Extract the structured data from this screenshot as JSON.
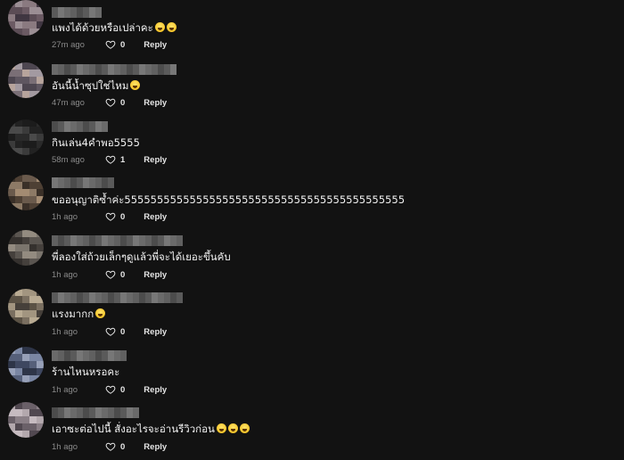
{
  "comments": [
    {
      "text": "แพงได้ด้วยหรือเปล่าคะ",
      "emoji_count": 2,
      "time": "27m ago",
      "likes": "0",
      "reply": "Reply"
    },
    {
      "text": "อันนี้น้ำซุปใช่ไหม",
      "emoji_count": 1,
      "time": "47m ago",
      "likes": "0",
      "reply": "Reply"
    },
    {
      "text": "กินเล่น4คำพอ5555",
      "emoji_count": 0,
      "time": "58m ago",
      "likes": "1",
      "reply": "Reply"
    },
    {
      "text": "ขออนุญาติซ้ำค่ะ5555555555555555555555555555555555555555555",
      "emoji_count": 0,
      "time": "1h ago",
      "likes": "0",
      "reply": "Reply"
    },
    {
      "text": "พี่ลองใส่ถ้วยเล็กๆดูแล้วพี่จะได้เยอะขึ้นคับ",
      "emoji_count": 0,
      "time": "1h ago",
      "likes": "0",
      "reply": "Reply"
    },
    {
      "text": "แรงมากก",
      "emoji_count": 1,
      "time": "1h ago",
      "likes": "0",
      "reply": "Reply"
    },
    {
      "text": "ร้านไหนหรอคะ",
      "emoji_count": 0,
      "time": "1h ago",
      "likes": "0",
      "reply": "Reply"
    },
    {
      "text": "เอาซะต่อไปนี้ สั่งอะไรจะอ่านรีวิวก่อน",
      "emoji_count": 3,
      "time": "1h ago",
      "likes": "0",
      "reply": "Reply"
    }
  ],
  "colors": {
    "background": "#121212",
    "text": "#f2f2f2",
    "meta_text": "#8a8a8a",
    "action_text": "#e6e6e6"
  },
  "icons": {
    "like": "heart-outline-icon",
    "emoji": "laughing-face-emoji"
  }
}
